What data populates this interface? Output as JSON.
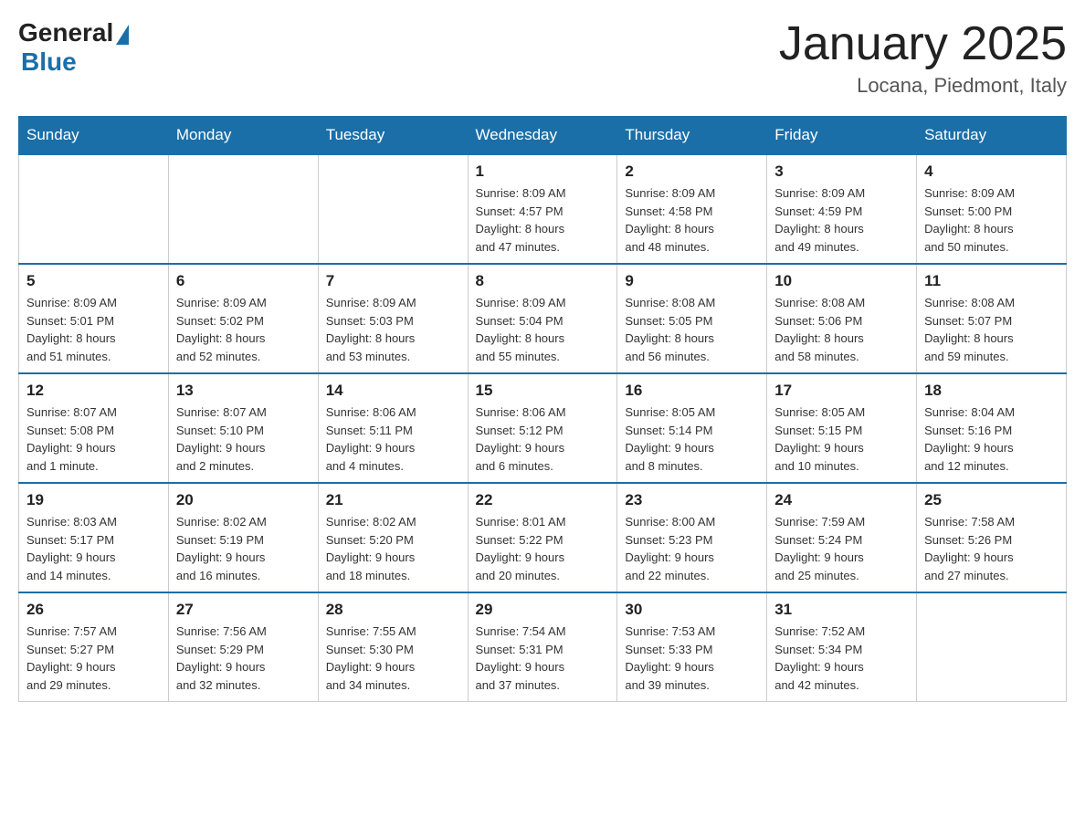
{
  "header": {
    "logo_general": "General",
    "logo_blue": "Blue",
    "month_title": "January 2025",
    "location": "Locana, Piedmont, Italy"
  },
  "weekdays": [
    "Sunday",
    "Monday",
    "Tuesday",
    "Wednesday",
    "Thursday",
    "Friday",
    "Saturday"
  ],
  "weeks": [
    [
      {
        "day": "",
        "info": ""
      },
      {
        "day": "",
        "info": ""
      },
      {
        "day": "",
        "info": ""
      },
      {
        "day": "1",
        "info": "Sunrise: 8:09 AM\nSunset: 4:57 PM\nDaylight: 8 hours\nand 47 minutes."
      },
      {
        "day": "2",
        "info": "Sunrise: 8:09 AM\nSunset: 4:58 PM\nDaylight: 8 hours\nand 48 minutes."
      },
      {
        "day": "3",
        "info": "Sunrise: 8:09 AM\nSunset: 4:59 PM\nDaylight: 8 hours\nand 49 minutes."
      },
      {
        "day": "4",
        "info": "Sunrise: 8:09 AM\nSunset: 5:00 PM\nDaylight: 8 hours\nand 50 minutes."
      }
    ],
    [
      {
        "day": "5",
        "info": "Sunrise: 8:09 AM\nSunset: 5:01 PM\nDaylight: 8 hours\nand 51 minutes."
      },
      {
        "day": "6",
        "info": "Sunrise: 8:09 AM\nSunset: 5:02 PM\nDaylight: 8 hours\nand 52 minutes."
      },
      {
        "day": "7",
        "info": "Sunrise: 8:09 AM\nSunset: 5:03 PM\nDaylight: 8 hours\nand 53 minutes."
      },
      {
        "day": "8",
        "info": "Sunrise: 8:09 AM\nSunset: 5:04 PM\nDaylight: 8 hours\nand 55 minutes."
      },
      {
        "day": "9",
        "info": "Sunrise: 8:08 AM\nSunset: 5:05 PM\nDaylight: 8 hours\nand 56 minutes."
      },
      {
        "day": "10",
        "info": "Sunrise: 8:08 AM\nSunset: 5:06 PM\nDaylight: 8 hours\nand 58 minutes."
      },
      {
        "day": "11",
        "info": "Sunrise: 8:08 AM\nSunset: 5:07 PM\nDaylight: 8 hours\nand 59 minutes."
      }
    ],
    [
      {
        "day": "12",
        "info": "Sunrise: 8:07 AM\nSunset: 5:08 PM\nDaylight: 9 hours\nand 1 minute."
      },
      {
        "day": "13",
        "info": "Sunrise: 8:07 AM\nSunset: 5:10 PM\nDaylight: 9 hours\nand 2 minutes."
      },
      {
        "day": "14",
        "info": "Sunrise: 8:06 AM\nSunset: 5:11 PM\nDaylight: 9 hours\nand 4 minutes."
      },
      {
        "day": "15",
        "info": "Sunrise: 8:06 AM\nSunset: 5:12 PM\nDaylight: 9 hours\nand 6 minutes."
      },
      {
        "day": "16",
        "info": "Sunrise: 8:05 AM\nSunset: 5:14 PM\nDaylight: 9 hours\nand 8 minutes."
      },
      {
        "day": "17",
        "info": "Sunrise: 8:05 AM\nSunset: 5:15 PM\nDaylight: 9 hours\nand 10 minutes."
      },
      {
        "day": "18",
        "info": "Sunrise: 8:04 AM\nSunset: 5:16 PM\nDaylight: 9 hours\nand 12 minutes."
      }
    ],
    [
      {
        "day": "19",
        "info": "Sunrise: 8:03 AM\nSunset: 5:17 PM\nDaylight: 9 hours\nand 14 minutes."
      },
      {
        "day": "20",
        "info": "Sunrise: 8:02 AM\nSunset: 5:19 PM\nDaylight: 9 hours\nand 16 minutes."
      },
      {
        "day": "21",
        "info": "Sunrise: 8:02 AM\nSunset: 5:20 PM\nDaylight: 9 hours\nand 18 minutes."
      },
      {
        "day": "22",
        "info": "Sunrise: 8:01 AM\nSunset: 5:22 PM\nDaylight: 9 hours\nand 20 minutes."
      },
      {
        "day": "23",
        "info": "Sunrise: 8:00 AM\nSunset: 5:23 PM\nDaylight: 9 hours\nand 22 minutes."
      },
      {
        "day": "24",
        "info": "Sunrise: 7:59 AM\nSunset: 5:24 PM\nDaylight: 9 hours\nand 25 minutes."
      },
      {
        "day": "25",
        "info": "Sunrise: 7:58 AM\nSunset: 5:26 PM\nDaylight: 9 hours\nand 27 minutes."
      }
    ],
    [
      {
        "day": "26",
        "info": "Sunrise: 7:57 AM\nSunset: 5:27 PM\nDaylight: 9 hours\nand 29 minutes."
      },
      {
        "day": "27",
        "info": "Sunrise: 7:56 AM\nSunset: 5:29 PM\nDaylight: 9 hours\nand 32 minutes."
      },
      {
        "day": "28",
        "info": "Sunrise: 7:55 AM\nSunset: 5:30 PM\nDaylight: 9 hours\nand 34 minutes."
      },
      {
        "day": "29",
        "info": "Sunrise: 7:54 AM\nSunset: 5:31 PM\nDaylight: 9 hours\nand 37 minutes."
      },
      {
        "day": "30",
        "info": "Sunrise: 7:53 AM\nSunset: 5:33 PM\nDaylight: 9 hours\nand 39 minutes."
      },
      {
        "day": "31",
        "info": "Sunrise: 7:52 AM\nSunset: 5:34 PM\nDaylight: 9 hours\nand 42 minutes."
      },
      {
        "day": "",
        "info": ""
      }
    ]
  ]
}
